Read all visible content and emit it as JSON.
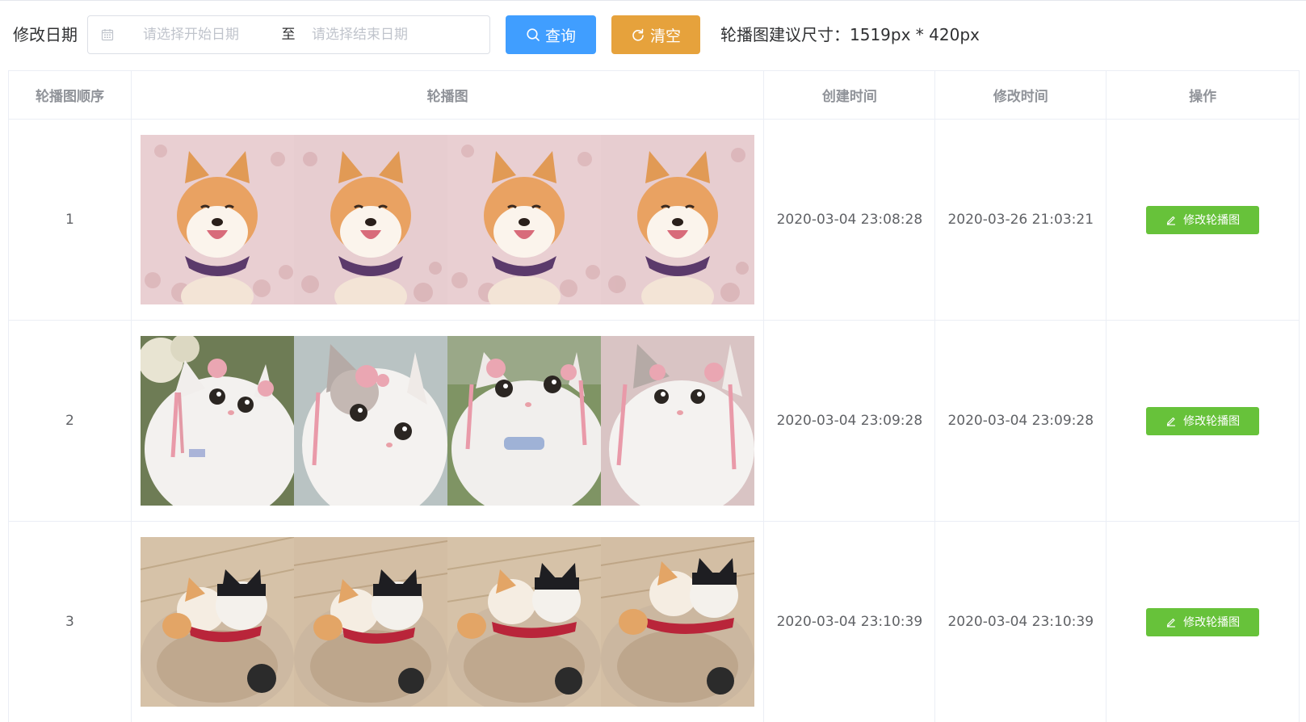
{
  "toolbar": {
    "filter_label": "修改日期",
    "start_placeholder": "请选择开始日期",
    "range_separator": "至",
    "end_placeholder": "请选择结束日期",
    "query_label": "查询",
    "clear_label": "清空",
    "size_hint": "轮播图建议尺寸：1519px * 420px",
    "query_color": "#409eff",
    "clear_color": "#e6a23c"
  },
  "table": {
    "columns": [
      "轮播图顺序",
      "轮播图",
      "创建时间",
      "修改时间",
      "操作"
    ],
    "rows": [
      {
        "order": "1",
        "image_subject": "shiba-inu-smiling-on-pink-flowers",
        "created": "2020-03-04 23:08:28",
        "modified": "2020-03-26 21:03:21",
        "action_label": "修改轮播图"
      },
      {
        "order": "2",
        "image_subject": "white-cats-with-pink-hair-ornaments",
        "created": "2020-03-04 23:09:28",
        "modified": "2020-03-04 23:09:28",
        "action_label": "修改轮播图"
      },
      {
        "order": "3",
        "image_subject": "shiba-dogs-in-pet-bed",
        "created": "2020-03-04 23:10:39",
        "modified": "2020-03-04 23:10:39",
        "action_label": "修改轮播图"
      }
    ],
    "edit_color": "#67c23a"
  },
  "icons": {
    "calendar": "calendar-icon",
    "search": "search-icon",
    "refresh": "refresh-icon",
    "edit": "edit-icon"
  }
}
